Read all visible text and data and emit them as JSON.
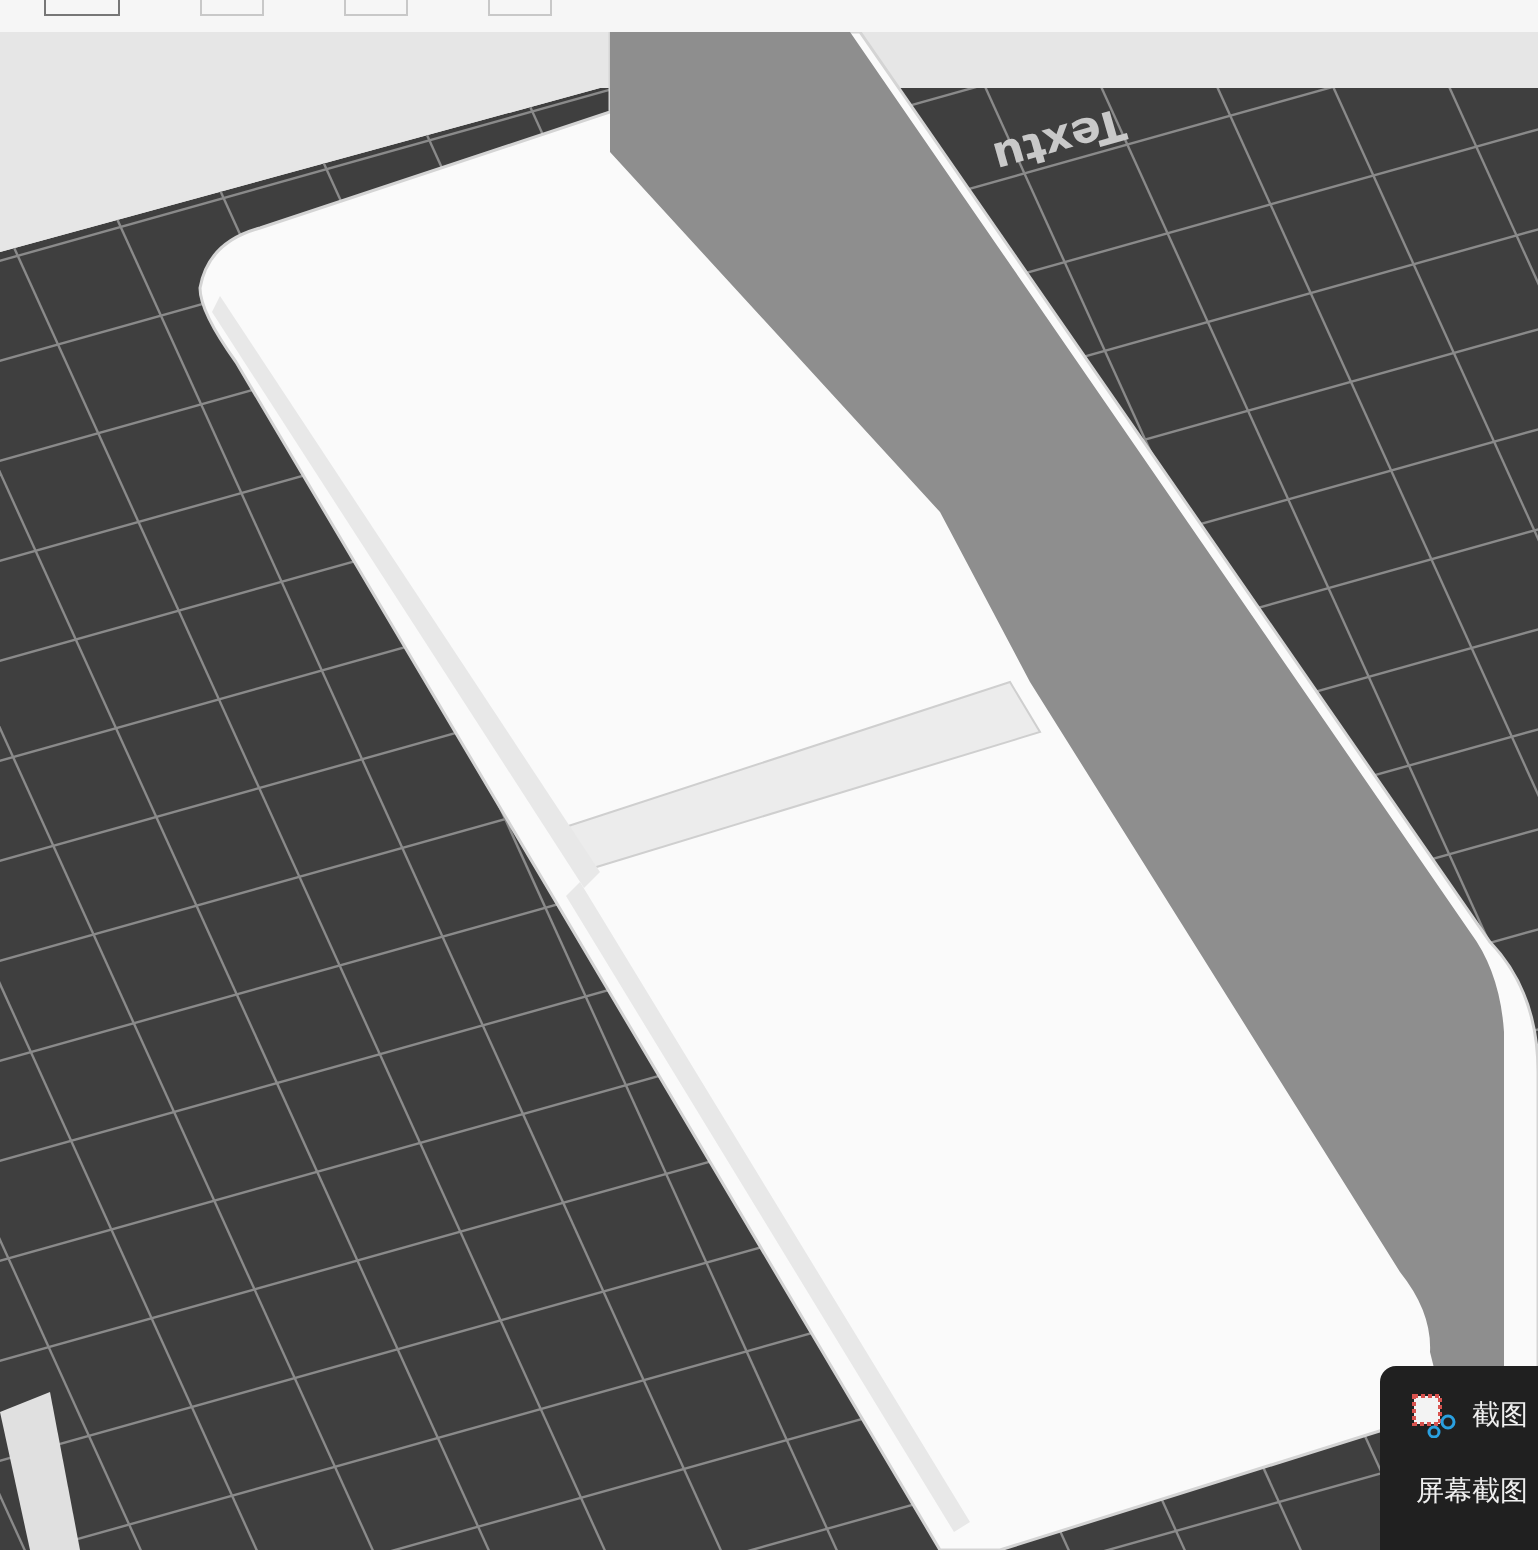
{
  "bed": {
    "label": "Textu"
  },
  "notification": {
    "title": "截图",
    "body": "屏幕截图"
  }
}
